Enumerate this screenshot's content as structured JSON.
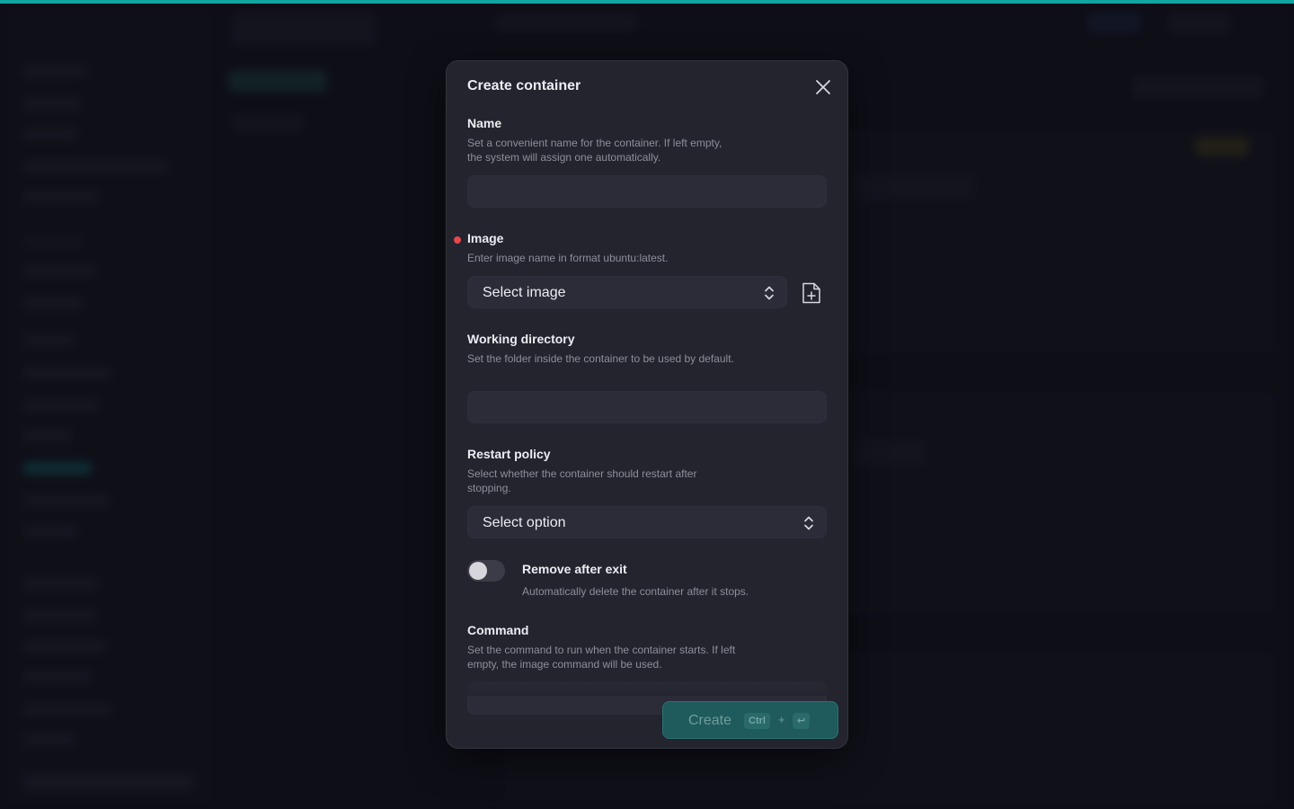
{
  "modal": {
    "title": "Create container",
    "fields": {
      "name": {
        "label": "Name",
        "description": "Set a convenient name for the container. If left empty, the system will assign one automatically.",
        "value": ""
      },
      "image": {
        "label": "Image",
        "required": true,
        "description": "Enter image name in format ubuntu:latest.",
        "select_placeholder": "Select image"
      },
      "working_directory": {
        "label": "Working directory",
        "description": "Set the folder inside the container to be used by default.",
        "value": ""
      },
      "restart_policy": {
        "label": "Restart policy",
        "description": "Select whether the container should restart after stopping.",
        "select_placeholder": "Select option"
      },
      "remove_after_exit": {
        "label": "Remove after exit",
        "description": "Automatically delete the container after it stops.",
        "enabled": false
      },
      "command": {
        "label": "Command",
        "description": "Set the command to run when the container starts. If left empty, the image command will be used.",
        "value": ""
      }
    },
    "create_button": {
      "label": "Create",
      "shortcut_key": "Ctrl",
      "shortcut_plus": "+",
      "shortcut_enter": "↩"
    }
  },
  "colors": {
    "accent": "#12a4a0",
    "required": "#e5484d",
    "modal_bg": "#24242f"
  }
}
